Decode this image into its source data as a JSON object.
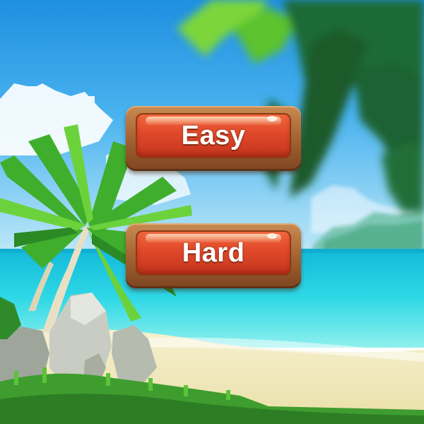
{
  "menu": {
    "buttons": [
      {
        "label": "Easy"
      },
      {
        "label": "Hard"
      }
    ]
  },
  "colors": {
    "button_fill": "#e0482a",
    "button_frame": "#a86634",
    "sky": "#3aa6e8",
    "sea": "#22d0e0",
    "sand": "#f3ecc4",
    "foliage": "#4bbf2e"
  }
}
